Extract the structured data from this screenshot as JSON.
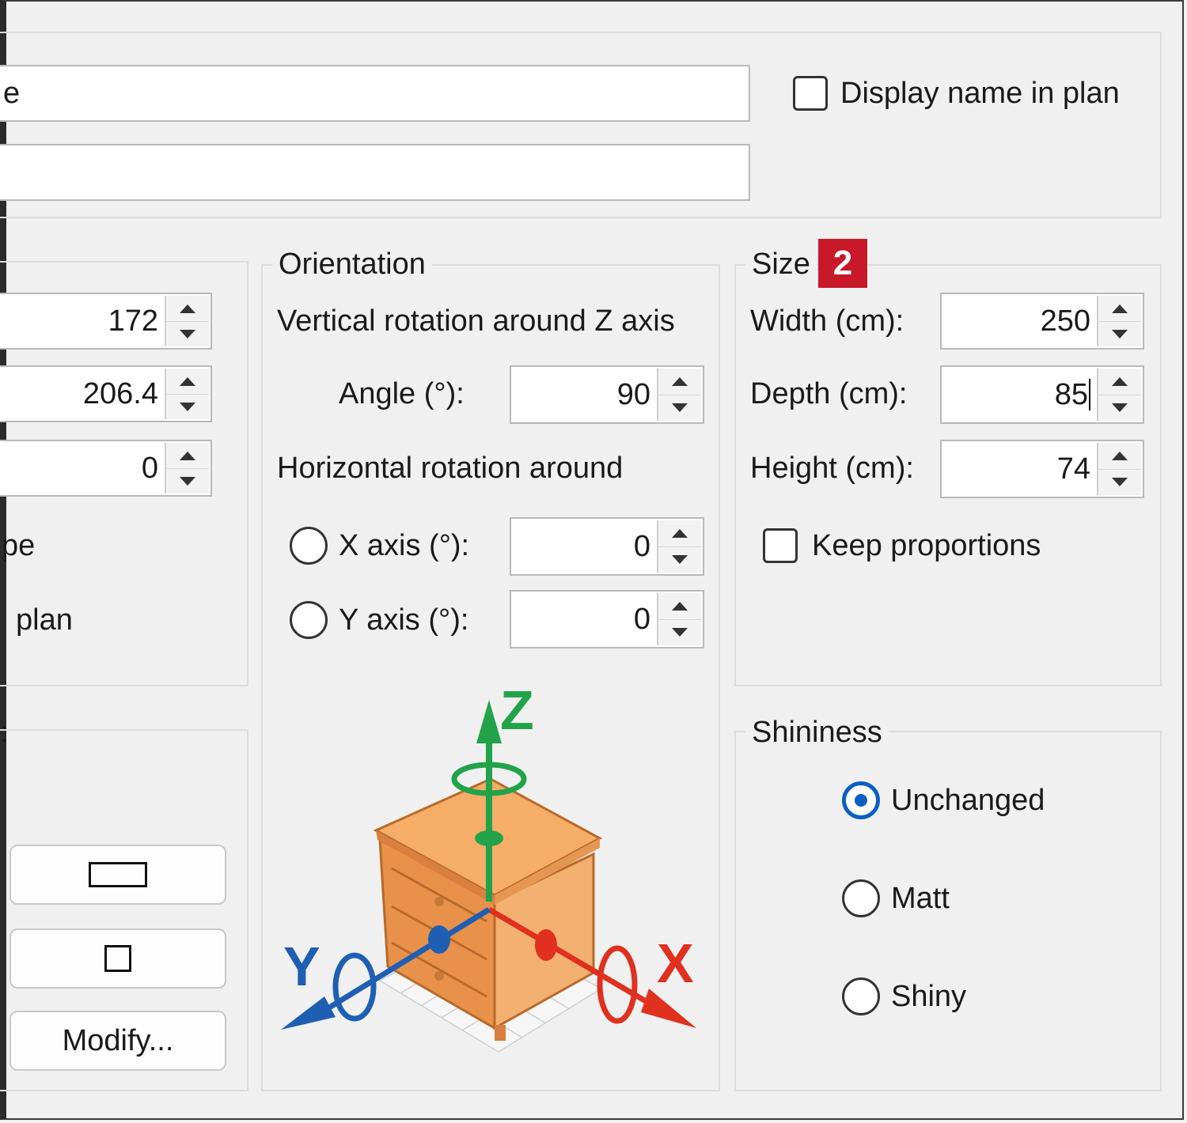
{
  "general": {
    "name_field_value_partial": "e",
    "description_field_value": "",
    "display_name_in_plan_label": "Display name in plan",
    "display_name_in_plan_checked": false
  },
  "location": {
    "x_value": "172",
    "y_value": "206.4",
    "elevation_value": "0",
    "partial_label_1": "pe",
    "partial_label_2": "plan",
    "partial_label_3": ":"
  },
  "color_texture": {
    "modify_label": "Modify..."
  },
  "orientation": {
    "legend": "Orientation",
    "vertical_label": "Vertical rotation around Z axis",
    "angle_label": "Angle (°):",
    "angle_value": "90",
    "horizontal_label": "Horizontal rotation around",
    "x_axis_label": "X axis (°):",
    "x_axis_value": "0",
    "y_axis_label": "Y axis (°):",
    "y_axis_value": "0",
    "axis_z": "Z",
    "axis_y": "Y",
    "axis_x": "X"
  },
  "size": {
    "legend": "Size",
    "badge": "2",
    "width_label": "Width (cm):",
    "width_value": "250",
    "depth_label": "Depth (cm):",
    "depth_value": "85",
    "height_label": "Height (cm):",
    "height_value": "74",
    "keep_proportions_label": "Keep proportions",
    "keep_proportions_checked": false
  },
  "shininess": {
    "legend": "Shininess",
    "options": [
      "Unchanged",
      "Matt",
      "Shiny"
    ],
    "selected": "Unchanged"
  },
  "colors": {
    "badge_red": "#c8182a",
    "radio_blue": "#0a5fc4",
    "axis_green": "#22a34a",
    "axis_red": "#e0301e",
    "axis_blue": "#1f5fb3",
    "wood": "#f2a55a"
  }
}
